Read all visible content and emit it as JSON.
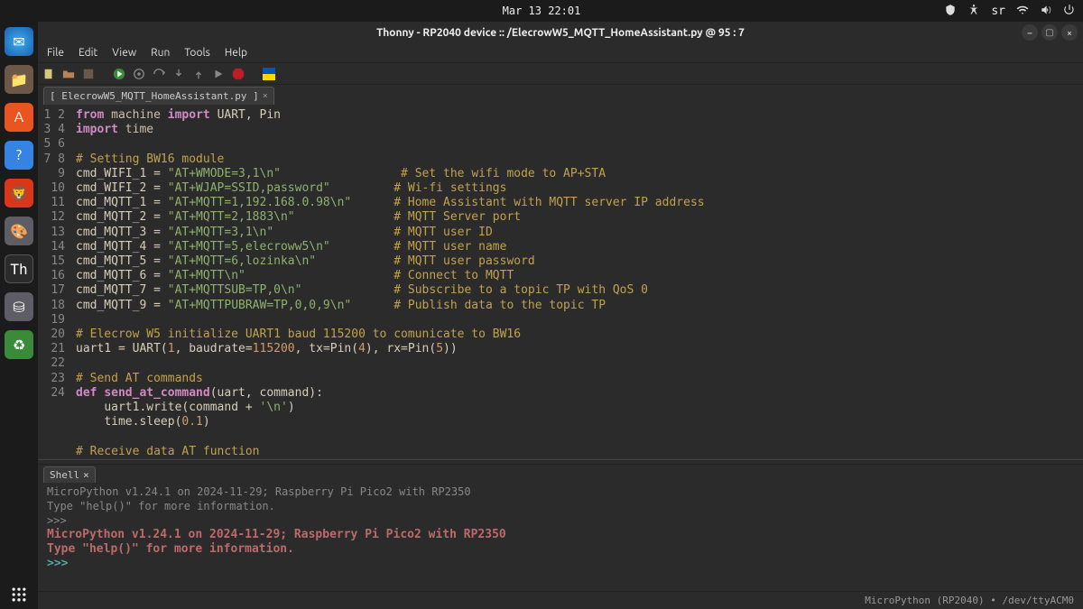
{
  "system": {
    "clock": "Mar 13  22:01",
    "tray": {
      "lang": "sr"
    }
  },
  "window": {
    "title": "Thonny  -  RP2040 device :: /ElecrowW5_MQTT_HomeAssistant.py  @  95 : 7"
  },
  "menubar": [
    "File",
    "Edit",
    "View",
    "Run",
    "Tools",
    "Help"
  ],
  "filetab": {
    "label": "[ ElecrowW5_MQTT_HomeAssistant.py ]"
  },
  "editor": {
    "lines": [
      "1",
      "2",
      "3",
      "4",
      "5",
      "6",
      "7",
      "8",
      "9",
      "10",
      "11",
      "12",
      "13",
      "14",
      "15",
      "16",
      "17",
      "18",
      "19",
      "20",
      "21",
      "22",
      "23",
      "24"
    ],
    "l1": {
      "kw1": "from",
      "mod": "machine",
      "kw2": "import",
      "ids": "UART, Pin"
    },
    "l2": {
      "kw": "import",
      "mod": "time"
    },
    "l4": "# Setting BW16 module",
    "l5": {
      "lhs": "cmd_WIFI_1 = ",
      "str": "\"AT+WMODE=3,1\\n\"",
      "pad": "                 ",
      "cmt": "# Set the wifi mode to AP+STA"
    },
    "l6": {
      "lhs": "cmd_WIFI_2 = ",
      "str": "\"AT+WJAP=SSID,password\"",
      "pad": "         ",
      "cmt": "# Wi-fi settings"
    },
    "l7": {
      "lhs": "cmd_MQTT_1 = ",
      "str": "\"AT+MQTT=1,192.168.0.98\\n\"",
      "pad": "      ",
      "cmt": "# Home Assistant with MQTT server IP address"
    },
    "l8": {
      "lhs": "cmd_MQTT_2 = ",
      "str": "\"AT+MQTT=2,1883\\n\"",
      "pad": "              ",
      "cmt": "# MQTT Server port"
    },
    "l9": {
      "lhs": "cmd_MQTT_3 = ",
      "str": "\"AT+MQTT=3,1\\n\"",
      "pad": "                 ",
      "cmt": "# MQTT user ID"
    },
    "l10": {
      "lhs": "cmd_MQTT_4 = ",
      "str": "\"AT+MQTT=5,elecroww5\\n\"",
      "pad": "         ",
      "cmt": "# MQTT user name"
    },
    "l11": {
      "lhs": "cmd_MQTT_5 = ",
      "str": "\"AT+MQTT=6,lozinka\\n\"",
      "pad": "           ",
      "cmt": "# MQTT user password"
    },
    "l12": {
      "lhs": "cmd_MQTT_6 = ",
      "str": "\"AT+MQTT\\n\"",
      "pad": "                     ",
      "cmt": "# Connect to MQTT"
    },
    "l13": {
      "lhs": "cmd_MQTT_7 = ",
      "str": "\"AT+MQTTSUB=TP,0\\n\"",
      "pad": "             ",
      "cmt": "# Subscribe to a topic TP with QoS 0"
    },
    "l14": {
      "lhs": "cmd_MQTT_9 = ",
      "str": "\"AT+MQTTPUBRAW=TP,0,0,9\\n\"",
      "pad": "      ",
      "cmt": "# Publish data to the topic TP"
    },
    "l16": "# Elecrow W5 initialize UART1 baud 115200 to comunicate to BW16",
    "l17": {
      "pre": "uart1 = UART(",
      "n1": "1",
      "mid1": ", baudrate=",
      "n2": "115200",
      "mid2": ", tx=Pin(",
      "n3": "4",
      "mid3": "), rx=Pin(",
      "n4": "5",
      "post": "))"
    },
    "l19": "# Send AT commands",
    "l20": {
      "kw": "def",
      "name": "send_at_command",
      "args": "(uart, command):"
    },
    "l21": {
      "indent": "    ",
      "body": "uart1.write(command + ",
      "str": "'\\n'",
      "post": ")"
    },
    "l22": {
      "indent": "    ",
      "body": "time.sleep(",
      "num": "0.1",
      "post": ")"
    },
    "l24": "# Receive data AT function"
  },
  "shell": {
    "tab": "Shell",
    "dim1": "MicroPython v1.24.1 on 2024-11-29; Raspberry Pi Pico2 with RP2350",
    "dim2": "Type \"help()\" for more information.",
    "dim3": ">>>",
    "banner1": "MicroPython v1.24.1 on 2024-11-29; Raspberry Pi Pico2 with RP2350",
    "banner2": "Type \"help()\" for more information.",
    "prompt": ">>> "
  },
  "statusbar": "MicroPython (RP2040)  •  /dev/ttyACM0"
}
